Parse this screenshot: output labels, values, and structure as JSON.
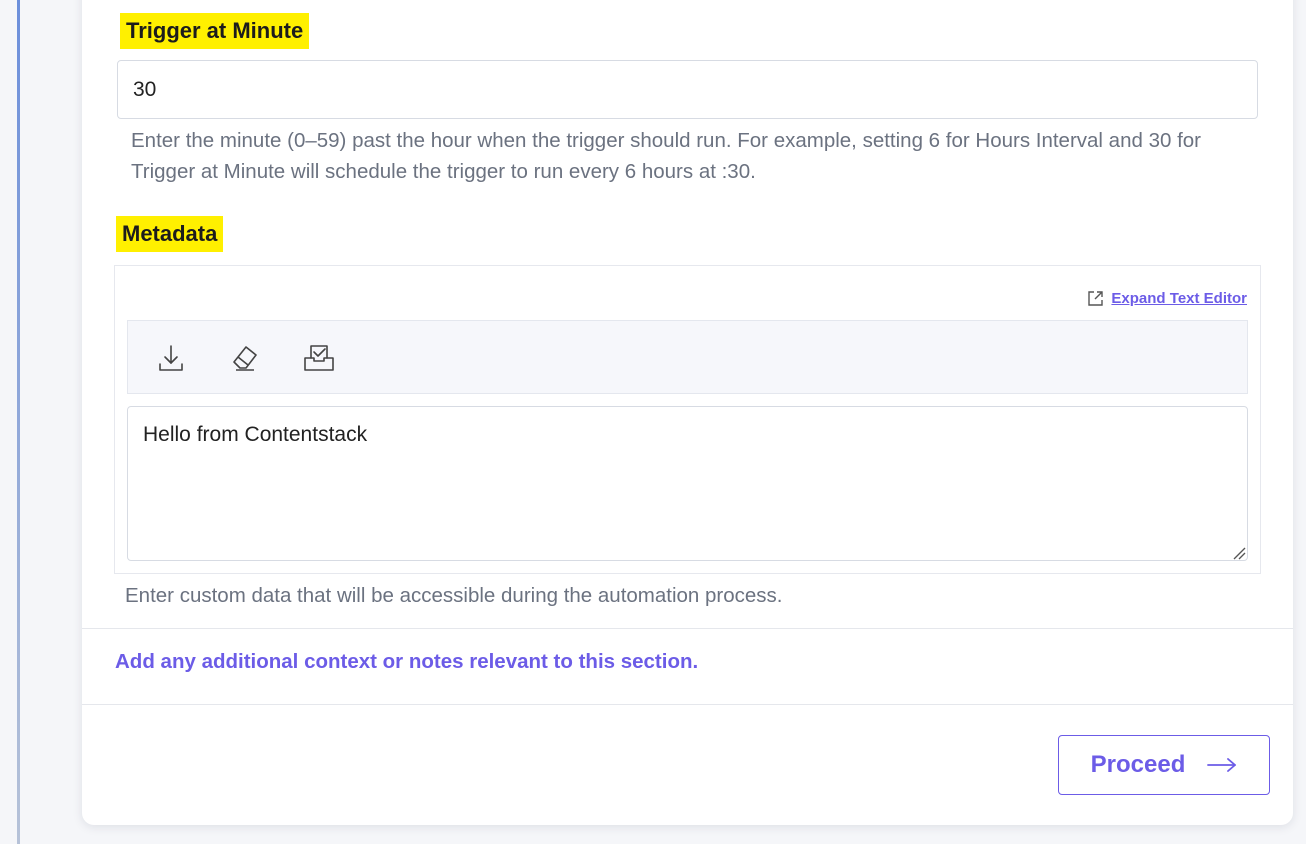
{
  "trigger_minute": {
    "label": "Trigger at Minute",
    "value": "30",
    "help": "Enter the minute (0–59) past the hour when the trigger should run. For example, setting 6 for Hours Interval and 30 for Trigger at Minute will schedule the trigger to run every 6 hours at :30."
  },
  "metadata": {
    "label": "Metadata",
    "expand_link": "Expand Text Editor",
    "toolbar": {
      "icons": [
        "download-icon",
        "eraser-icon",
        "inbox-check-icon"
      ]
    },
    "editor_value": "Hello from Contentstack",
    "help": "Enter custom data that will be accessible during the automation process."
  },
  "notes": {
    "text": "Add any additional context or notes relevant to this section."
  },
  "footer": {
    "proceed_label": "Proceed"
  },
  "colors": {
    "accent": "#6c5ce7",
    "highlight": "#fff000",
    "help_text": "#6b7280"
  }
}
